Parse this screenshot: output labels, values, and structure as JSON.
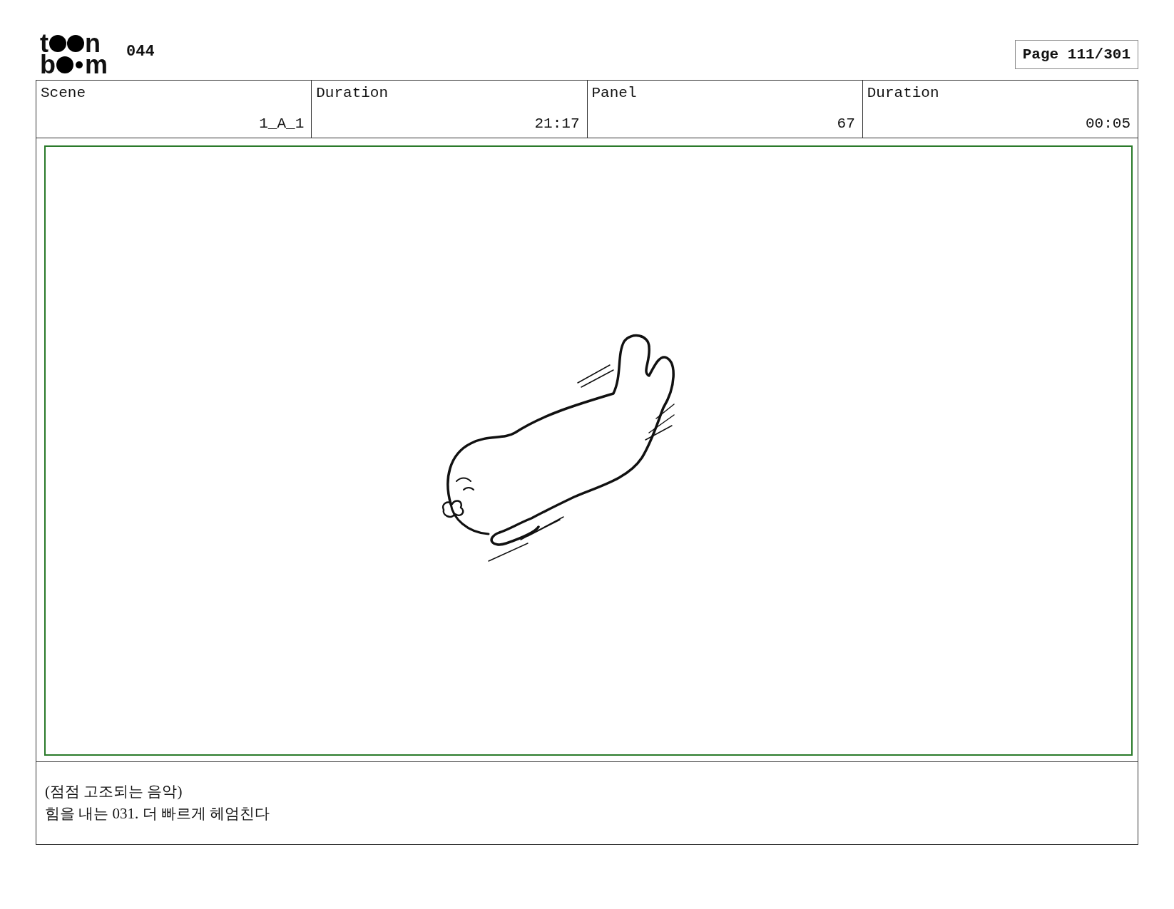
{
  "logo": [
    {
      "start": "t",
      "end": "n"
    },
    {
      "start": "b",
      "end": "m"
    }
  ],
  "sequence": "044",
  "page": "Page 111/301",
  "info_table": {
    "columns": [
      "Scene",
      "Duration",
      "Panel",
      "Duration"
    ],
    "rows": [
      [
        "1_A_1",
        "21:17",
        "67",
        "00:05"
      ]
    ]
  },
  "notes": [
    "(점점 고조되는 음악)",
    "힘을 내는 031. 더 빠르게 헤엄친다"
  ]
}
